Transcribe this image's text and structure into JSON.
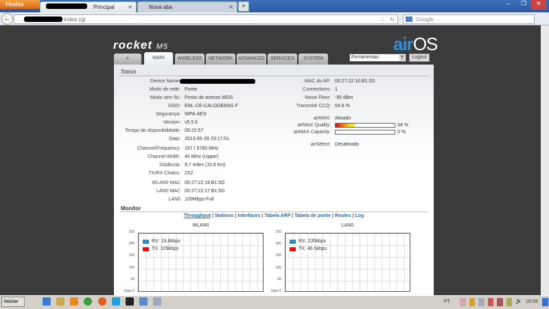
{
  "browser": {
    "menu_label": "Firefox",
    "tabs": [
      {
        "label": "Principal",
        "active": true
      },
      {
        "label": "Nova aba",
        "active": false
      }
    ],
    "url": "index.cgi",
    "search_placeholder": "Google"
  },
  "app": {
    "logo": "rocket",
    "model": "M5",
    "brand_air": "air",
    "brand_os": "OS",
    "nav": [
      "MAIN",
      "WIRELESS",
      "NETWORK",
      "ADVANCED",
      "SERVICES",
      "SYSTEM"
    ],
    "tools_label": "Ferramentas:",
    "logout_label": "Logout"
  },
  "status": {
    "title": "Status",
    "left": [
      {
        "label": "Device Name:",
        "value": ""
      },
      {
        "label": "Modo de rede:",
        "value": "Ponte"
      },
      {
        "label": "Modo sem fio:",
        "value": "Ponto de acesso WDS"
      },
      {
        "label": "SSID:",
        "value": "ENL-CE-CALOGERAS F"
      },
      {
        "label": "Segurança:",
        "value": "WPA-AES"
      },
      {
        "label": "Version:",
        "value": "v5.5.6"
      },
      {
        "label": "Tempo de disponibilidade:",
        "value": "05:22:57"
      },
      {
        "label": "Data:",
        "value": "2013-05-28 23:17:51"
      },
      {
        "label": "Channel/Frequency:",
        "value": "157 / 5785 MHz"
      },
      {
        "label": "Channel Width:",
        "value": "40 MHz (Upper)"
      },
      {
        "label": "Distância:",
        "value": "9.7 miles (15.6 km)"
      },
      {
        "label": "TX/RX Chains:",
        "value": "2X2"
      },
      {
        "label": "WLAN0 MAC",
        "value": "00:27:22:16:B1:5D"
      },
      {
        "label": "LAN0 MAC",
        "value": "00:27:22:17:B1:5D"
      },
      {
        "label": "LAN0",
        "value": "100Mbps-Full"
      }
    ],
    "right": [
      {
        "label": "MAC do AP:",
        "value": "00:27:22:16:B1:5D"
      },
      {
        "label": "Connections:",
        "value": "1"
      },
      {
        "label": "Noise Floor:",
        "value": "-95 dBm"
      },
      {
        "label": "Transmitir CCQ:",
        "value": "54.6 %"
      },
      {
        "label": "airMAX:",
        "value": "Ativado"
      },
      {
        "label": "airMAX Quality:",
        "value": "34 %",
        "percent": 34
      },
      {
        "label": "airMAX Capacity:",
        "value": "0 %",
        "percent": 0
      },
      {
        "label": "airSelect:",
        "value": "Desativado"
      }
    ]
  },
  "monitor": {
    "title": "Monitor",
    "links": [
      "Throughput",
      "Stations",
      "Interfaces",
      "Tabela ARP",
      "Tabela de ponte",
      "Routes",
      "Log"
    ],
    "charts": [
      {
        "title": "WLAN0",
        "rx": "RX: 19.8kbps",
        "tx": "TX: 229kbps"
      },
      {
        "title": "LAN0",
        "rx": "RX: 235kbps",
        "tx": "TX: 46.5kbps"
      }
    ],
    "yticks": [
      "250",
      "200",
      "150",
      "100",
      "50",
      "kbps 0"
    ],
    "colors": {
      "rx": "#2e88c4",
      "tx": "#e01010"
    }
  },
  "taskbar": {
    "start": "Iniciar",
    "lang": "PT",
    "clock": "16:59"
  }
}
